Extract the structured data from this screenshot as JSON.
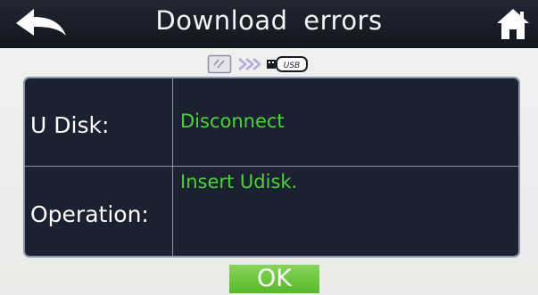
{
  "header": {
    "title": "Download errors",
    "back_icon": "back-arrow-icon",
    "home_icon": "home-icon"
  },
  "status_icons": {
    "device_icon": "memory-card-icon",
    "transfer_icon": "double-chevron-right-icon",
    "usb_label": "USB"
  },
  "panel": {
    "rows": [
      {
        "label": "U Disk:",
        "value": "Disconnect"
      },
      {
        "label": "Operation:",
        "value": "Insert Udisk."
      }
    ]
  },
  "ok_label": "OK",
  "colors": {
    "titlebar": "#1a1d27",
    "panel_bg": "#1b2130",
    "value_text": "#4ed23c",
    "ok_button": "#6cc63e"
  }
}
